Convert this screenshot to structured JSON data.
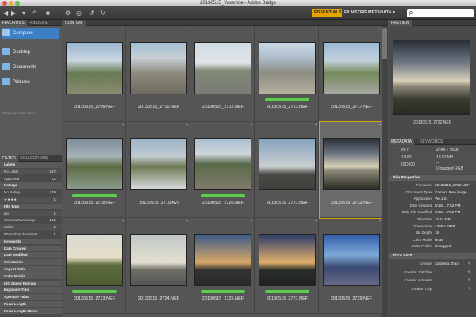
{
  "window": {
    "title": "20130515_Yosemite - Adobe Bridge"
  },
  "toolbar": {
    "icons": [
      "back-icon",
      "forward-icon",
      "sort-icon",
      "boomerang-icon",
      "camera-icon",
      "refine-icon",
      "open-in-camera-raw-icon",
      "rotate-ccw-icon",
      "rotate-cw-icon",
      "search-icon"
    ],
    "workspaces": [
      "ESSENTIALS",
      "FILMSTRIP",
      "METADATA"
    ],
    "active_workspace": "ESSENTIALS",
    "search_glyph": "ρ",
    "accent": "#e6a300"
  },
  "left_panel": {
    "tabs": [
      "FAVORITES",
      "FOLDERS"
    ],
    "favorites": [
      "Computer",
      "Desktop",
      "Documents",
      "Pictures"
    ],
    "hint": "Drag Favorites Here...",
    "filter_tabs": [
      "FILTER",
      "COLLECTIONS"
    ],
    "filters": [
      {
        "label": "Labels",
        "header": true
      },
      {
        "label": "No Label",
        "count": "137"
      },
      {
        "label": "Approved",
        "count": "41"
      },
      {
        "label": "Ratings",
        "header": true
      },
      {
        "label": "No Rating",
        "count": "179"
      },
      {
        "label": "★★★★",
        "count": "1"
      },
      {
        "label": "File Type",
        "header": true
      },
      {
        "label": "avi",
        "count": "1"
      },
      {
        "label": "Camera Raw image",
        "count": "181"
      },
      {
        "label": "Folder",
        "count": "1"
      },
      {
        "label": "Photoshop document",
        "count": "1"
      },
      {
        "label": "Keywords",
        "header": true
      },
      {
        "label": "Date Created",
        "header": true
      },
      {
        "label": "Date Modified",
        "header": true
      },
      {
        "label": "Orientation",
        "header": true
      },
      {
        "label": "Aspect Ratio",
        "header": true
      },
      {
        "label": "Color Profile",
        "header": true
      },
      {
        "label": "ISO Speed Ratings",
        "header": true
      },
      {
        "label": "Exposure Time",
        "header": true
      },
      {
        "label": "Aperture Value",
        "header": true
      },
      {
        "label": "Focal Length",
        "header": true
      },
      {
        "label": "Focal Length 35mm",
        "header": true
      }
    ]
  },
  "content": {
    "tab": "CONTENT",
    "label_color": "#5ccf4e",
    "selected_color": "#d9a300",
    "thumbnails": [
      {
        "name": "20130515_2709.NEF",
        "label": false
      },
      {
        "name": "20130515_2710.NEF",
        "label": false
      },
      {
        "name": "20130515_2712.NEF",
        "label": false
      },
      {
        "name": "20130515_2713.NEF",
        "label": true
      },
      {
        "name": "20130515_2717.NEF",
        "label": false
      },
      {
        "name": "20130515_2718.NEF",
        "label": true
      },
      {
        "name": "20130515_2719.AVI",
        "label": false
      },
      {
        "name": "20130515_2720.NEF",
        "label": true
      },
      {
        "name": "20130515_2721.NEF",
        "label": false
      },
      {
        "name": "20130515_2722.NEF",
        "label": false,
        "selected": true
      },
      {
        "name": "20130515_2723.NEF",
        "label": true
      },
      {
        "name": "20130515_2724.NEF",
        "label": false
      },
      {
        "name": "20130515_2725.NEF",
        "label": true
      },
      {
        "name": "20130515_2727.NEF",
        "label": true
      },
      {
        "name": "20130515_2729.NEF",
        "label": false
      }
    ]
  },
  "right_panel": {
    "preview_tab": "PREVIEW",
    "preview_caption": "20130515_2722.NEF",
    "metadata_tabs": [
      "METADATA",
      "KEYWORDS"
    ],
    "camera": {
      "aperture": "f/8.0",
      "shutter": "1/160",
      "iso": "ISO100",
      "dims": "4288 x 2848",
      "size": "10.52 MB",
      "misc": "--",
      "profile": "Untagged RGB"
    },
    "file_properties_title": "File Properties",
    "file_properties": [
      {
        "k": "Filename",
        "v": "20130515_2722.NEF"
      },
      {
        "k": "Document Type",
        "v": "Camera Raw image"
      },
      {
        "k": "Application",
        "v": "Ver.1.01"
      },
      {
        "k": "Date Created",
        "v": "5/15/... 7:52 PM"
      },
      {
        "k": "Date File Modified",
        "v": "5/16/... 7:52 PM"
      },
      {
        "k": "File Size",
        "v": "10.52 MB"
      },
      {
        "k": "Dimensions",
        "v": "4288 x 2848"
      },
      {
        "k": "Bit Depth",
        "v": "16"
      },
      {
        "k": "Color Mode",
        "v": "RGB"
      },
      {
        "k": "Color Profile",
        "v": "Untagged"
      }
    ],
    "iptc_title": "IPTC Core",
    "iptc": [
      {
        "k": "Creator",
        "v": "Xiaofeng Zhao"
      },
      {
        "k": "Creator: Job Title",
        "v": ""
      },
      {
        "k": "Creator: Address",
        "v": ""
      },
      {
        "k": "Creator: City",
        "v": ""
      }
    ]
  }
}
